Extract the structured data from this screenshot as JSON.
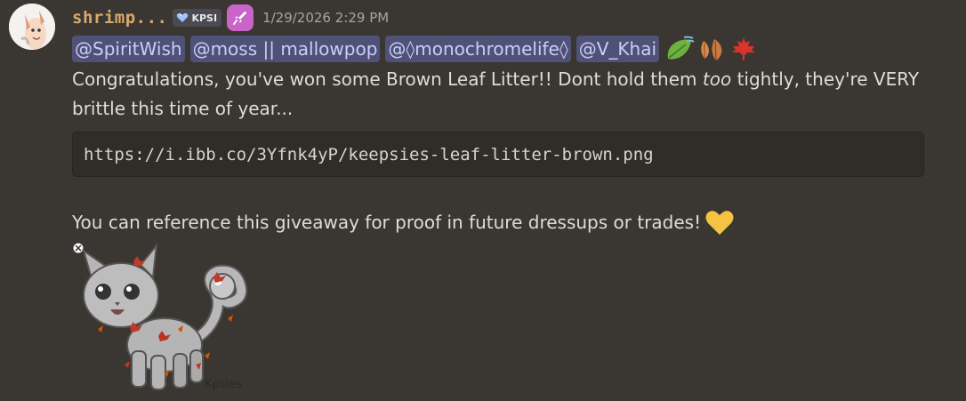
{
  "author": {
    "name": "shrimp...",
    "guild_tag": "KPSI",
    "timestamp": "1/29/2026 2:29 PM"
  },
  "mentions": [
    "@SpiritWish",
    "@moss || mallowpop",
    "@◊monochromelife◊",
    "@V_Khai"
  ],
  "emojis": [
    "leaf-fluttering-icon",
    "fallen-leaf-icon",
    "maple-leaf-icon"
  ],
  "message": {
    "line1_before": "Congratulations, you've won some Brown Leaf Litter!! Dont hold them ",
    "line1_emph": "too",
    "line1_after": " tightly, they're VERY brittle this time of year...",
    "link": "https://i.ibb.co/3Yfnk4yP/keepsies-leaf-litter-brown.png",
    "reference": "You can reference this giveaway for proof in future dressups or trades!"
  },
  "attachment": {
    "watermark": "Kpsies"
  },
  "colors": {
    "background": "#3a3631",
    "username": "#d9a86b",
    "mention_bg": "#4f5276",
    "mention_text": "#c9cdfb",
    "code_bg": "#302c28",
    "heart": "#f5c242"
  }
}
